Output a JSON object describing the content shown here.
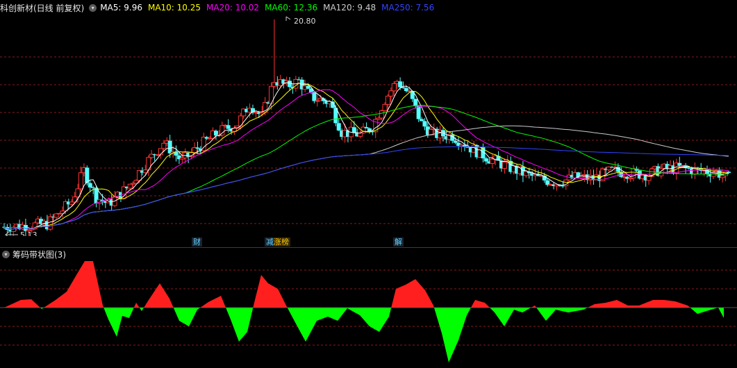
{
  "main": {
    "title": "科创新材(日线 前复权)",
    "menu_icon": "chevron-down-icon",
    "ma": [
      {
        "label": "MA5: 9.96",
        "color": "#ffffff"
      },
      {
        "label": "MA10: 10.25",
        "color": "#ffff00"
      },
      {
        "label": "MA20: 10.02",
        "color": "#ff00ff"
      },
      {
        "label": "MA60: 12.36",
        "color": "#00ff00"
      },
      {
        "label": "MA120: 9.48",
        "color": "#cccccc"
      },
      {
        "label": "MA250: 7.56",
        "color": "#3344ff"
      }
    ],
    "high_label": "20.80",
    "low_label": "5.13",
    "events": [
      {
        "label": "财",
        "color": "#5fd0ff"
      },
      {
        "label": "减",
        "color": "#5fd0ff"
      },
      {
        "label": "涨榜",
        "color": "#ffcc00"
      },
      {
        "label": "解",
        "color": "#5fd0ff"
      }
    ]
  },
  "sub": {
    "title": "筹码带状图(3)",
    "menu_icon": "chevron-down-icon"
  },
  "footer": {
    "text": "..."
  }
}
